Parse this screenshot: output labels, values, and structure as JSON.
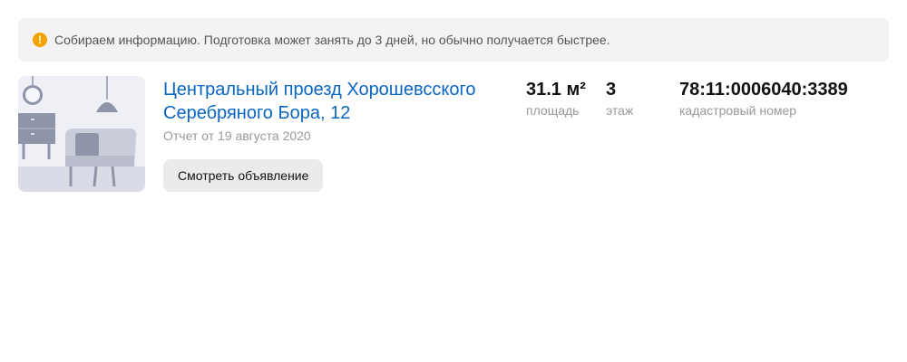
{
  "notice": {
    "icon": "warning-icon",
    "icon_glyph": "!",
    "icon_color": "#f5a300",
    "text": "Собираем информацию. Подготовка может занять до 3 дней, но обычно получается быстрее."
  },
  "listing": {
    "title": "Центральный проезд Хорошевсского Серебряного Бора, 12",
    "report_date": "Отчет от 19 августа 2020",
    "view_button_label": "Смотреть объявление",
    "image_icon": "room-interior-illustration",
    "link_color": "#0a66c2",
    "stats": {
      "area": {
        "value": "31.1 м²",
        "label": "площадь"
      },
      "floor": {
        "value": "3",
        "label": "этаж"
      },
      "cadastral": {
        "value": "78:11:0006040:3389",
        "label": "кадастровый номер"
      }
    }
  }
}
